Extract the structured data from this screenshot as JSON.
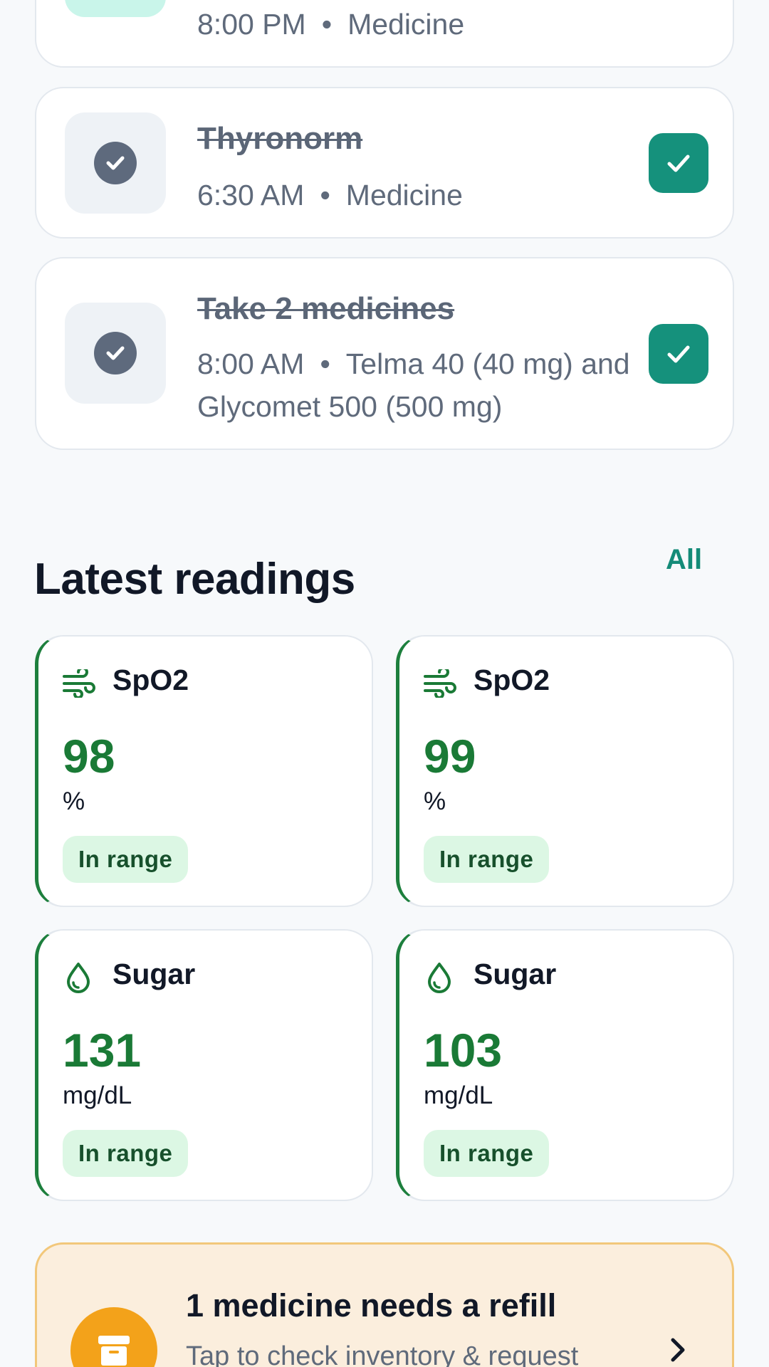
{
  "tasks": [
    {
      "title": "",
      "time": "8:00 PM",
      "separator": "•",
      "detail": "Medicine",
      "done": false,
      "icon": "pill-box-icon"
    },
    {
      "title": "Thyronorm",
      "time": "6:30 AM",
      "separator": "•",
      "detail": "Medicine",
      "done": true,
      "icon": "check-circle-icon"
    },
    {
      "title": "Take 2 medicines",
      "time": "8:00 AM",
      "separator": "•",
      "detail": "Telma 40 (40 mg) and Glycomet 500 (500 mg)",
      "done": true,
      "icon": "check-circle-icon"
    }
  ],
  "readings_section": {
    "title": "Latest readings",
    "all_label": "All"
  },
  "readings": [
    {
      "name": "SpO2",
      "value": "98",
      "unit": "%",
      "status": "In range",
      "icon": "wind-icon"
    },
    {
      "name": "SpO2",
      "value": "99",
      "unit": "%",
      "status": "In range",
      "icon": "wind-icon"
    },
    {
      "name": "Sugar",
      "value": "131",
      "unit": "mg/dL",
      "status": "In range",
      "icon": "drop-icon"
    },
    {
      "name": "Sugar",
      "value": "103",
      "unit": "mg/dL",
      "status": "In range",
      "icon": "drop-icon"
    }
  ],
  "refill": {
    "title": "1 medicine needs a refill",
    "subtitle": "Tap to check inventory & request",
    "icon": "archive-box-icon"
  },
  "colors": {
    "accent": "#15917c",
    "reading_value": "#1a7a36",
    "badge_bg": "#dcf7e4",
    "refill_bg": "#fbeedd",
    "refill_icon": "#f3a21a"
  }
}
